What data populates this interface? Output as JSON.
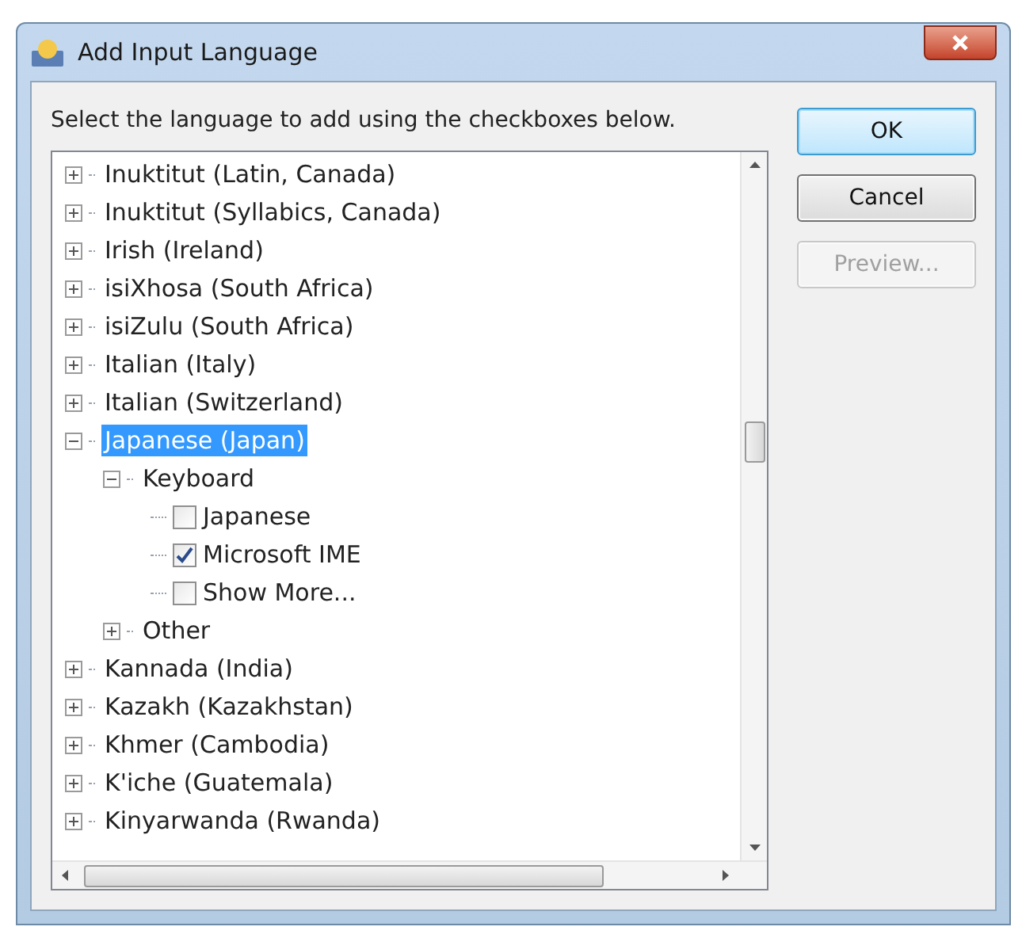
{
  "window": {
    "title": "Add Input Language"
  },
  "instruction": "Select the language to add using the checkboxes below.",
  "tree": [
    {
      "kind": "node",
      "label": "Inuktitut (Latin, Canada)",
      "expanded": false,
      "selected": false
    },
    {
      "kind": "node",
      "label": "Inuktitut (Syllabics, Canada)",
      "expanded": false,
      "selected": false
    },
    {
      "kind": "node",
      "label": "Irish (Ireland)",
      "expanded": false,
      "selected": false
    },
    {
      "kind": "node",
      "label": "isiXhosa (South Africa)",
      "expanded": false,
      "selected": false
    },
    {
      "kind": "node",
      "label": "isiZulu (South Africa)",
      "expanded": false,
      "selected": false
    },
    {
      "kind": "node",
      "label": "Italian (Italy)",
      "expanded": false,
      "selected": false
    },
    {
      "kind": "node",
      "label": "Italian (Switzerland)",
      "expanded": false,
      "selected": false
    },
    {
      "kind": "node",
      "label": "Japanese (Japan)",
      "expanded": true,
      "selected": true,
      "children": [
        {
          "kind": "node",
          "label": "Keyboard",
          "expanded": true,
          "selected": false,
          "children": [
            {
              "kind": "checkbox",
              "label": "Japanese",
              "checked": false
            },
            {
              "kind": "checkbox",
              "label": "Microsoft IME",
              "checked": true
            },
            {
              "kind": "checkbox",
              "label": "Show More...",
              "checked": false
            }
          ]
        },
        {
          "kind": "node",
          "label": "Other",
          "expanded": false,
          "selected": false
        }
      ]
    },
    {
      "kind": "node",
      "label": "Kannada (India)",
      "expanded": false,
      "selected": false
    },
    {
      "kind": "node",
      "label": "Kazakh (Kazakhstan)",
      "expanded": false,
      "selected": false
    },
    {
      "kind": "node",
      "label": "Khmer (Cambodia)",
      "expanded": false,
      "selected": false
    },
    {
      "kind": "node",
      "label": "K'iche (Guatemala)",
      "expanded": false,
      "selected": false
    },
    {
      "kind": "node",
      "label": "Kinyarwanda (Rwanda)",
      "expanded": false,
      "selected": false
    }
  ],
  "buttons": [
    {
      "label": "OK",
      "kind": "default",
      "disabled": false
    },
    {
      "label": "Cancel",
      "kind": "normal",
      "disabled": false
    },
    {
      "label": "Preview...",
      "kind": "normal",
      "disabled": true
    }
  ]
}
